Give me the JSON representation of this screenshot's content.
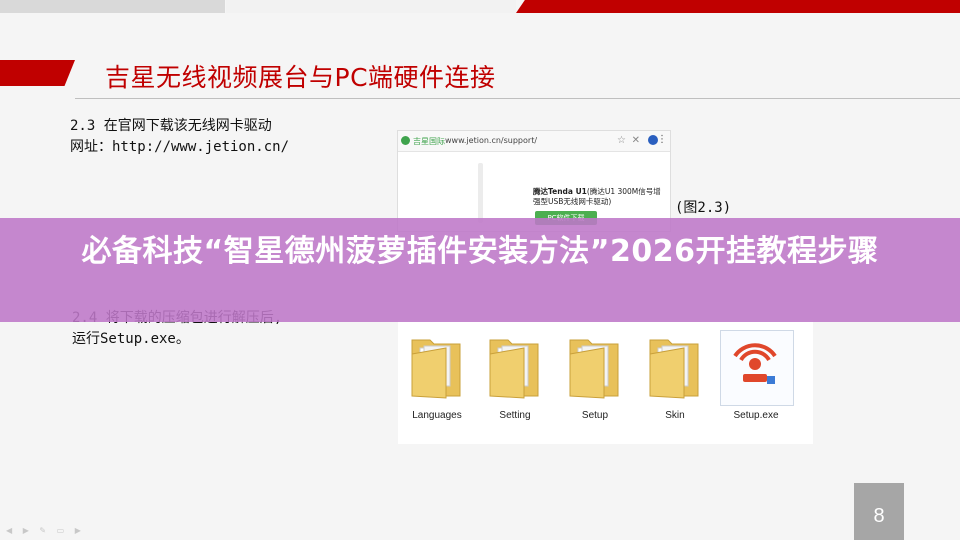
{
  "slide": {
    "title": "吉星无线视频展台与PC端硬件连接",
    "page_number": "8"
  },
  "step_2_3": {
    "line1": "2.3 在官网下载该无线网卡驱动",
    "line2": "网址：http://www.jetion.cn/"
  },
  "browser": {
    "site_name": "吉星国际",
    "url": "www.jetion.cn/support/",
    "product_title": "腾达Tenda U1",
    "product_desc": "(腾达U1 300M信号增强型USB无线网卡驱动)",
    "download_button": "PC软件下载"
  },
  "figure_caption": "(图2.3)",
  "step_2_4": {
    "line1": "2.4 将下载的压缩包进行解压后,",
    "line2": "运行Setup.exe。"
  },
  "files": [
    {
      "label": "Languages",
      "icon": "folder-icon"
    },
    {
      "label": "Setting",
      "icon": "folder-icon"
    },
    {
      "label": "Setup",
      "icon": "folder-icon"
    },
    {
      "label": "Skin",
      "icon": "folder-icon"
    },
    {
      "label": "Setup.exe",
      "icon": "tenda-setup-icon"
    }
  ],
  "overlay": {
    "headline": "必备科技“智星德州菠萝插件安装方法”2026开挂教程步骤"
  },
  "colors": {
    "accent_red": "#c00000",
    "overlay_purple": "#be78c8",
    "page_box_gray": "#a6a6a6"
  }
}
